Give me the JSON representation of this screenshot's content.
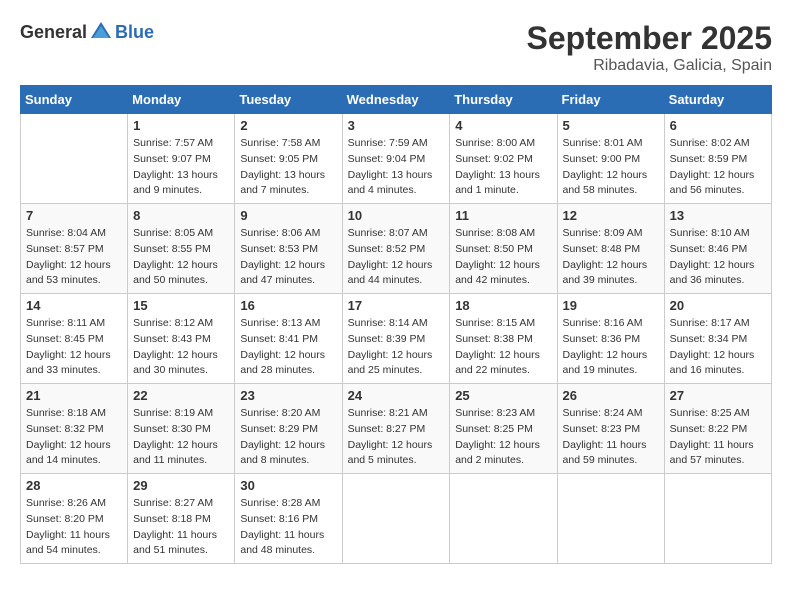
{
  "header": {
    "logo_general": "General",
    "logo_blue": "Blue",
    "month": "September 2025",
    "location": "Ribadavia, Galicia, Spain"
  },
  "weekdays": [
    "Sunday",
    "Monday",
    "Tuesday",
    "Wednesday",
    "Thursday",
    "Friday",
    "Saturday"
  ],
  "weeks": [
    [
      {
        "day": "",
        "info": ""
      },
      {
        "day": "1",
        "info": "Sunrise: 7:57 AM\nSunset: 9:07 PM\nDaylight: 13 hours\nand 9 minutes."
      },
      {
        "day": "2",
        "info": "Sunrise: 7:58 AM\nSunset: 9:05 PM\nDaylight: 13 hours\nand 7 minutes."
      },
      {
        "day": "3",
        "info": "Sunrise: 7:59 AM\nSunset: 9:04 PM\nDaylight: 13 hours\nand 4 minutes."
      },
      {
        "day": "4",
        "info": "Sunrise: 8:00 AM\nSunset: 9:02 PM\nDaylight: 13 hours\nand 1 minute."
      },
      {
        "day": "5",
        "info": "Sunrise: 8:01 AM\nSunset: 9:00 PM\nDaylight: 12 hours\nand 58 minutes."
      },
      {
        "day": "6",
        "info": "Sunrise: 8:02 AM\nSunset: 8:59 PM\nDaylight: 12 hours\nand 56 minutes."
      }
    ],
    [
      {
        "day": "7",
        "info": "Sunrise: 8:04 AM\nSunset: 8:57 PM\nDaylight: 12 hours\nand 53 minutes."
      },
      {
        "day": "8",
        "info": "Sunrise: 8:05 AM\nSunset: 8:55 PM\nDaylight: 12 hours\nand 50 minutes."
      },
      {
        "day": "9",
        "info": "Sunrise: 8:06 AM\nSunset: 8:53 PM\nDaylight: 12 hours\nand 47 minutes."
      },
      {
        "day": "10",
        "info": "Sunrise: 8:07 AM\nSunset: 8:52 PM\nDaylight: 12 hours\nand 44 minutes."
      },
      {
        "day": "11",
        "info": "Sunrise: 8:08 AM\nSunset: 8:50 PM\nDaylight: 12 hours\nand 42 minutes."
      },
      {
        "day": "12",
        "info": "Sunrise: 8:09 AM\nSunset: 8:48 PM\nDaylight: 12 hours\nand 39 minutes."
      },
      {
        "day": "13",
        "info": "Sunrise: 8:10 AM\nSunset: 8:46 PM\nDaylight: 12 hours\nand 36 minutes."
      }
    ],
    [
      {
        "day": "14",
        "info": "Sunrise: 8:11 AM\nSunset: 8:45 PM\nDaylight: 12 hours\nand 33 minutes."
      },
      {
        "day": "15",
        "info": "Sunrise: 8:12 AM\nSunset: 8:43 PM\nDaylight: 12 hours\nand 30 minutes."
      },
      {
        "day": "16",
        "info": "Sunrise: 8:13 AM\nSunset: 8:41 PM\nDaylight: 12 hours\nand 28 minutes."
      },
      {
        "day": "17",
        "info": "Sunrise: 8:14 AM\nSunset: 8:39 PM\nDaylight: 12 hours\nand 25 minutes."
      },
      {
        "day": "18",
        "info": "Sunrise: 8:15 AM\nSunset: 8:38 PM\nDaylight: 12 hours\nand 22 minutes."
      },
      {
        "day": "19",
        "info": "Sunrise: 8:16 AM\nSunset: 8:36 PM\nDaylight: 12 hours\nand 19 minutes."
      },
      {
        "day": "20",
        "info": "Sunrise: 8:17 AM\nSunset: 8:34 PM\nDaylight: 12 hours\nand 16 minutes."
      }
    ],
    [
      {
        "day": "21",
        "info": "Sunrise: 8:18 AM\nSunset: 8:32 PM\nDaylight: 12 hours\nand 14 minutes."
      },
      {
        "day": "22",
        "info": "Sunrise: 8:19 AM\nSunset: 8:30 PM\nDaylight: 12 hours\nand 11 minutes."
      },
      {
        "day": "23",
        "info": "Sunrise: 8:20 AM\nSunset: 8:29 PM\nDaylight: 12 hours\nand 8 minutes."
      },
      {
        "day": "24",
        "info": "Sunrise: 8:21 AM\nSunset: 8:27 PM\nDaylight: 12 hours\nand 5 minutes."
      },
      {
        "day": "25",
        "info": "Sunrise: 8:23 AM\nSunset: 8:25 PM\nDaylight: 12 hours\nand 2 minutes."
      },
      {
        "day": "26",
        "info": "Sunrise: 8:24 AM\nSunset: 8:23 PM\nDaylight: 11 hours\nand 59 minutes."
      },
      {
        "day": "27",
        "info": "Sunrise: 8:25 AM\nSunset: 8:22 PM\nDaylight: 11 hours\nand 57 minutes."
      }
    ],
    [
      {
        "day": "28",
        "info": "Sunrise: 8:26 AM\nSunset: 8:20 PM\nDaylight: 11 hours\nand 54 minutes."
      },
      {
        "day": "29",
        "info": "Sunrise: 8:27 AM\nSunset: 8:18 PM\nDaylight: 11 hours\nand 51 minutes."
      },
      {
        "day": "30",
        "info": "Sunrise: 8:28 AM\nSunset: 8:16 PM\nDaylight: 11 hours\nand 48 minutes."
      },
      {
        "day": "",
        "info": ""
      },
      {
        "day": "",
        "info": ""
      },
      {
        "day": "",
        "info": ""
      },
      {
        "day": "",
        "info": ""
      }
    ]
  ]
}
